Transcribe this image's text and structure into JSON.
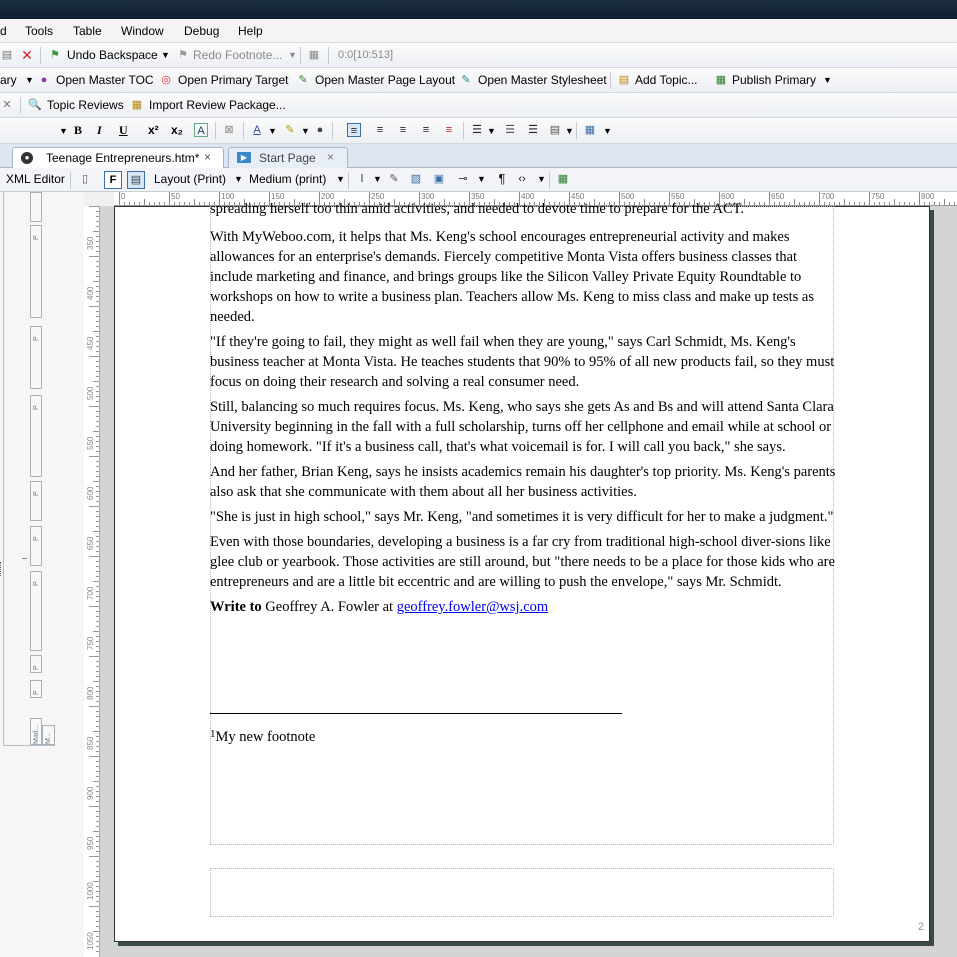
{
  "menu": [
    "d",
    "Tools",
    "Table",
    "Window",
    "Debug",
    "Help"
  ],
  "toolbar1": {
    "undo_label": "Undo Backspace",
    "redo_label": "Redo Footnote...",
    "position": "0:0[10:513]"
  },
  "toolbar2": {
    "primary_label": "ary",
    "open_master_toc": "Open Master TOC",
    "open_primary_target": "Open Primary Target",
    "open_master_page_layout": "Open Master Page Layout",
    "open_master_stylesheet": "Open Master Stylesheet",
    "add_topic": "Add Topic...",
    "publish_primary": "Publish Primary"
  },
  "toolbar3": {
    "topic_reviews": "Topic Reviews",
    "import_review_package": "Import Review Package..."
  },
  "format_toolbar": {
    "bold": "B",
    "italic": "I",
    "underline": "U",
    "superscript": "x²",
    "subscript": "x₂"
  },
  "tabs": [
    {
      "label": "Teenage Entrepreneurs.htm*",
      "close": "×"
    },
    {
      "label": "Start Page",
      "close": "×"
    }
  ],
  "editor_bar": {
    "xml_editor": "XML Editor",
    "layout": "Layout (Print)",
    "medium": "Medium (print)"
  },
  "ruler_labels": [
    "0",
    "50",
    "100",
    "150",
    "200",
    "250",
    "300",
    "350",
    "400",
    "450",
    "500",
    "550",
    "600",
    "650",
    "700",
    "750",
    "800"
  ],
  "vruler_labels": [
    "350",
    "400",
    "450",
    "500",
    "550",
    "600",
    "650",
    "700",
    "750",
    "800",
    "850",
    "900",
    "950",
    "1000",
    "1050"
  ],
  "structure_labels": [
    "P",
    "P",
    "P",
    "P",
    "P",
    "P",
    "P",
    "P",
    "P",
    "Mad...",
    "M..."
  ],
  "document": {
    "top_partial": "spreading herself too thin amid activities, and needed to devote time to prepare for the ACT.",
    "paragraphs": [
      "With MyWeboo.com, it helps that Ms. Keng's school encourages entrepreneurial activity and makes allowances for an enterprise's demands. Fiercely competitive Monta Vista offers business classes that include marketing and finance, and brings groups like the Silicon Valley Private Equity Roundtable to workshops on how to write a business plan. Teachers allow Ms. Keng to miss class and make up tests as needed.",
      "\"If they're going to fail, they might as well fail when they are young,\" says Carl Schmidt, Ms. Keng's business teacher at Monta Vista. He teaches students that 90% to 95% of all new products fail, so they must focus on doing their research and solving a real consumer need.",
      "Still, balancing so much requires focus. Ms. Keng, who says she gets As and Bs and will attend Santa Clara University beginning in the fall with a full scholarship, turns off her cellphone and email while at school or doing homework. \"If it's a business call, that's what voicemail is for. I will call you back,\" she says.",
      "And her father, Brian Keng, says he insists academics remain his daughter's top priority. Ms. Keng's parents also ask that she communicate with them about all her business activities.",
      "\"She is just in high school,\" says Mr. Keng, \"and sometimes it is very difficult for her to make a judgment.\"",
      "Even with those boundaries, developing a business is a far cry from traditional high-school diver-sions like glee club or yearbook. Those activities are still around, but \"there needs to be a place for those kids who are entrepreneurs and are a little bit eccentric and are willing to push the envelope,\" says Mr. Schmidt."
    ],
    "write_to_label": "Write to",
    "write_to_name": "Geoffrey A. Fowler at",
    "email": "geoffrey.fowler@wsj.com",
    "footnote_number": "1",
    "footnote_text": "My new footnote",
    "page_number": "2"
  }
}
